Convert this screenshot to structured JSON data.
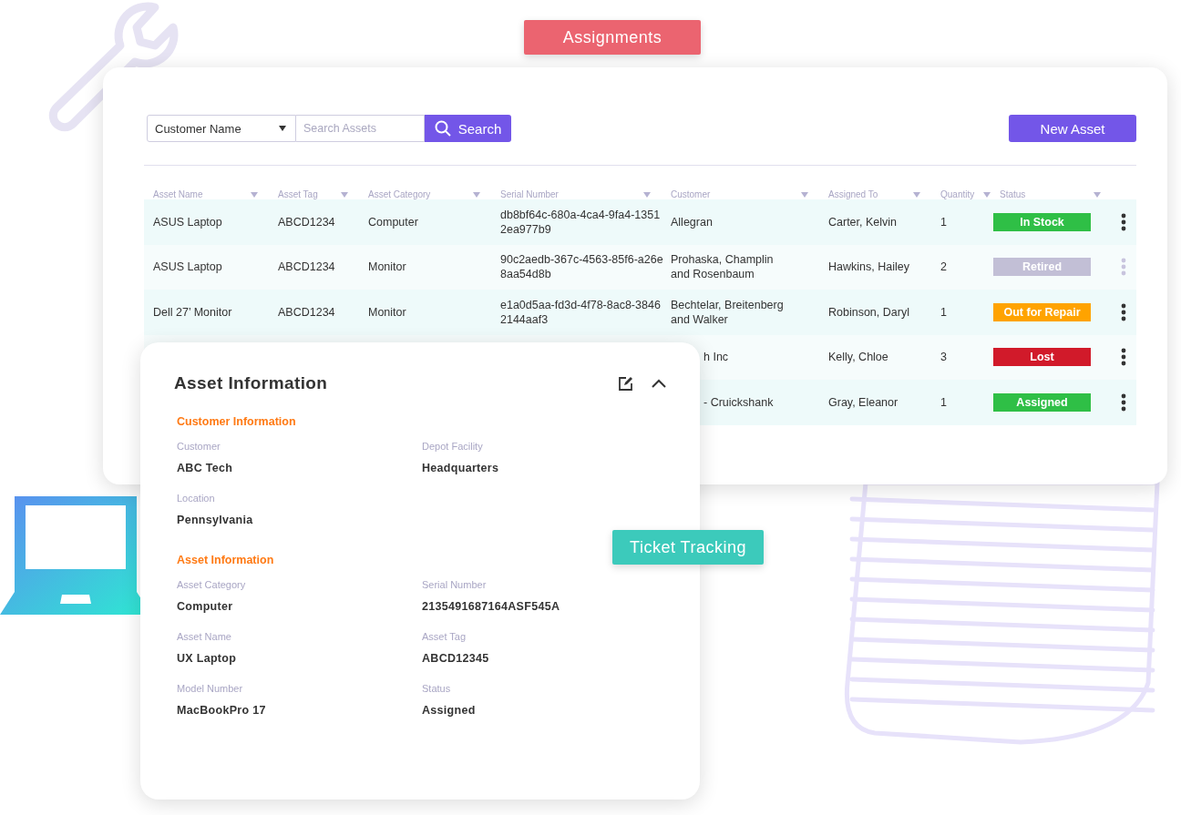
{
  "tags": [
    {
      "label": "Assignments",
      "color": "#eb6470"
    },
    {
      "label": "Ticket Tracking",
      "color": "#3ccabb"
    }
  ],
  "filter": {
    "dropdown": "Customer Name",
    "placeholder": "Search Assets",
    "button": "Search"
  },
  "new_button": "New Asset",
  "table": {
    "columns": [
      "Asset Name",
      "Asset Tag",
      "Asset Category",
      "Serial Number",
      "Customer",
      "Assigned To",
      "Quantity",
      "Status"
    ],
    "rows": [
      {
        "name": "ASUS Laptop",
        "tag": "ABCD1234",
        "category": "Computer",
        "serial": "db8bf64c-680a-4ca4-9fa4-13512ea977b9",
        "customer": "Allegran",
        "assigned": "Carter, Kelvin",
        "quantity": "1",
        "status": "In Stock",
        "color": "#2fbf46",
        "menu_disabled": false
      },
      {
        "name": "ASUS Laptop",
        "tag": "ABCD1234",
        "category": "Monitor",
        "serial": "90c2aedb-367c-4563-85f6-a26e8aa54d8b",
        "customer": "Prohaska, Champlin and Rosenbaum",
        "assigned": "Hawkins, Hailey",
        "quantity": "2",
        "status": "Retired",
        "color": "#c2bfd6",
        "menu_disabled": true
      },
      {
        "name": "Dell 27’ Monitor",
        "tag": "ABCD1234",
        "category": "Monitor",
        "serial": "e1a0d5aa-fd3d-4f78-8ac8-38462144aaf3",
        "customer": "Bechtelar, Breitenberg and Walker",
        "assigned": "Robinson, Daryl",
        "quantity": "1",
        "status": "Out for Repair",
        "color": "#ffa300",
        "menu_disabled": false
      },
      {
        "customer": "h Inc",
        "assigned": "Kelly, Chloe",
        "quantity": "3",
        "status": "Lost",
        "color": "#d11a2a",
        "menu_disabled": false
      },
      {
        "customer": "- Cruickshank",
        "assigned": "Gray, Eleanor",
        "quantity": "1",
        "status": "Assigned",
        "color": "#2fbf46",
        "menu_disabled": false
      }
    ]
  },
  "detail": {
    "title": "Asset Information",
    "sections": [
      {
        "heading": "Customer Information",
        "fields": [
          {
            "label": "Customer",
            "value": "ABC Tech"
          },
          {
            "label": "Depot Facility",
            "value": "Headquarters"
          },
          {
            "label": "Location",
            "value": "Pennsylvania"
          }
        ]
      },
      {
        "heading": "Asset Information",
        "fields": [
          {
            "label": "Asset Category",
            "value": "Computer"
          },
          {
            "label": "Serial Number",
            "value": "2135491687164ASF545A"
          },
          {
            "label": "Asset Name",
            "value": "UX Laptop"
          },
          {
            "label": "Asset Tag",
            "value": "ABCD12345"
          },
          {
            "label": "Model Number",
            "value": "MacBookPro 17"
          },
          {
            "label": "Status",
            "value": "Assigned"
          }
        ]
      }
    ]
  }
}
